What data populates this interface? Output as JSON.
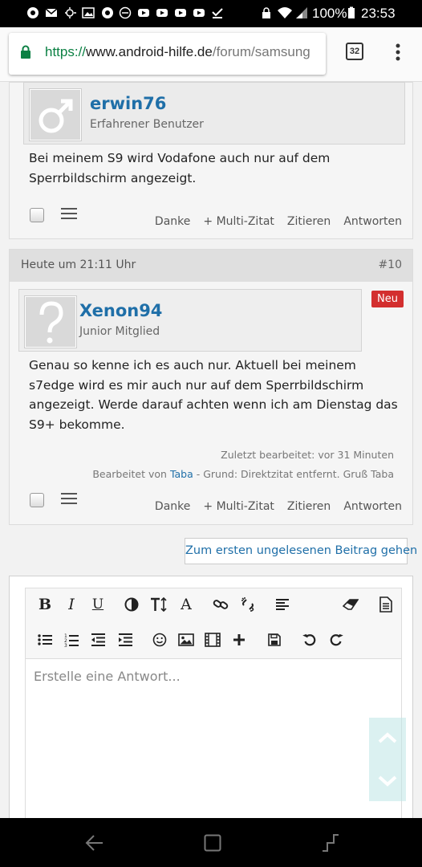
{
  "status_bar": {
    "battery": "100%",
    "time": "23:53"
  },
  "browser": {
    "url_scheme": "https://",
    "url_host": "www.android-hilfe.de",
    "url_path": "/forum/samsung",
    "tab_count": "32"
  },
  "post1": {
    "username": "erwin76",
    "rank": "Erfahrener Benutzer",
    "text": "Bei meinem S9 wird Vodafone auch nur auf dem Sperrbildschirm angezeigt.",
    "actions": [
      "Danke",
      "+ Multi-Zitat",
      "Zitieren",
      "Antworten"
    ]
  },
  "post2": {
    "date": "Heute um 21:11 Uhr",
    "number": "#10",
    "badge": "Neu",
    "username": "Xenon94",
    "rank": "Junior Mitglied",
    "text": "Genau so kenne ich es auch nur. Aktuell bei meinem s7edge wird es mir auch nur auf dem Sperrbildschirm angezeigt. Werde darauf achten wenn ich am Dienstag das S9+ bekomme.",
    "edited_last": "Zuletzt bearbeitet: vor 31 Minuten",
    "edited_by_prefix": "Bearbeitet von",
    "edited_by_user": "Taba",
    "edited_reason": "- Grund: Direktzitat entfernt. Gruß Taba",
    "actions": [
      "Danke",
      "+ Multi-Zitat",
      "Zitieren",
      "Antworten"
    ]
  },
  "unread_link": "Zum ersten ungelesenen Beitrag gehen",
  "editor": {
    "placeholder": "Erstelle eine Antwort...",
    "bold": "B",
    "italic": "I",
    "underline": "U",
    "font": "A"
  },
  "colors": {
    "link": "#1f6fa8",
    "badge": "#d32f2f",
    "secure": "#0b8043"
  }
}
